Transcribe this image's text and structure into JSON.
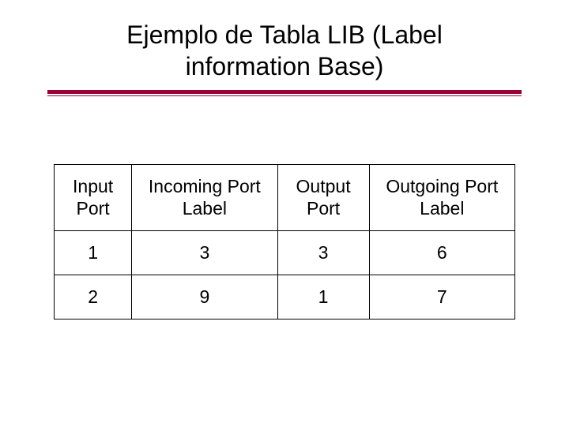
{
  "title": "Ejemplo de Tabla LIB (Label information Base)",
  "table": {
    "headers": [
      "Input Port",
      "Incoming Port Label",
      "Output Port",
      "Outgoing Port Label"
    ],
    "rows": [
      [
        "1",
        "3",
        "3",
        "6"
      ],
      [
        "2",
        "9",
        "1",
        "7"
      ]
    ]
  },
  "chart_data": {
    "type": "table",
    "title": "Ejemplo de Tabla LIB (Label information Base)",
    "columns": [
      "Input Port",
      "Incoming Port Label",
      "Output Port",
      "Outgoing Port Label"
    ],
    "rows": [
      {
        "Input Port": 1,
        "Incoming Port Label": 3,
        "Output Port": 3,
        "Outgoing Port Label": 6
      },
      {
        "Input Port": 2,
        "Incoming Port Label": 9,
        "Output Port": 1,
        "Outgoing Port Label": 7
      }
    ]
  }
}
